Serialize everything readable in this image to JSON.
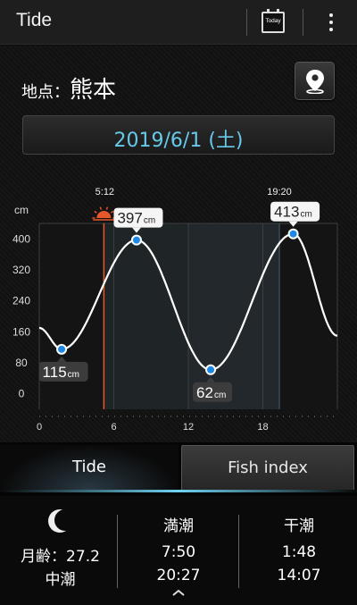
{
  "app": {
    "title": "Tide",
    "today_icon_label": "Today"
  },
  "location": {
    "label": "地点：",
    "name": "熊本"
  },
  "date": "2019/6/1 (土)",
  "chart_data": {
    "type": "line",
    "ylabel": "cm",
    "y_ticks": [
      "400",
      "320",
      "240",
      "160",
      "80",
      "0"
    ],
    "ylim": [
      -40,
      440
    ],
    "x_ticks": [
      "0",
      "6",
      "12",
      "18"
    ],
    "xlim": [
      0,
      24
    ],
    "sunrise": {
      "label": "5:12",
      "hour": 5.2
    },
    "sunset": {
      "label": "19:20",
      "hour": 19.33
    },
    "series": [
      {
        "x": [
          0,
          1.8,
          7.83,
          13.8,
          20.45,
          24
        ],
        "y": [
          170,
          115,
          397,
          62,
          413,
          150
        ]
      }
    ],
    "extremes": [
      {
        "hour": 1.8,
        "value": 115,
        "text": "115",
        "unit": "cm",
        "kind": "low"
      },
      {
        "hour": 7.83,
        "value": 397,
        "text": "397",
        "unit": "cm",
        "kind": "high"
      },
      {
        "hour": 13.8,
        "value": 62,
        "text": "62",
        "unit": "cm",
        "kind": "low"
      },
      {
        "hour": 20.45,
        "value": 413,
        "text": "413",
        "unit": "cm",
        "kind": "high"
      }
    ],
    "colors": {
      "line": "#ffffff",
      "marker": "#1e88e5",
      "sunrise": "#e6572a",
      "sunset": "#1e88e5"
    }
  },
  "tabs": {
    "tide": "Tide",
    "fish_index": "Fish index"
  },
  "info": {
    "moon_age": "月齢：27.2",
    "tide_type": "中潮",
    "high_tide_header": "満潮",
    "high_tide_times": [
      "7:50",
      "20:27"
    ],
    "low_tide_header": "干潮",
    "low_tide_times": [
      "1:48",
      "14:07"
    ]
  }
}
